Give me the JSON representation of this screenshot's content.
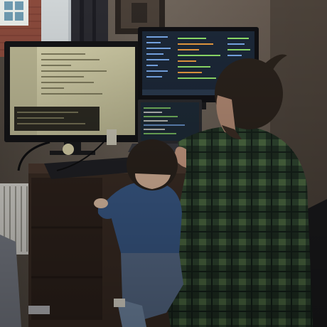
{
  "photo": {
    "scene": "desk-with-monitors",
    "colors": {
      "wall": "#6e645a",
      "wall_shadow": "#3a332c",
      "window_light": "#cfd4d6",
      "brick": "#8a4a3c",
      "curtain": "#2a2a30",
      "desk": "#3a2c24",
      "monitor_left_screen": "#cdc9a6",
      "monitor_top_screen": "#1c2838",
      "laptop_screen": "#1d2a36",
      "code_green": "#8fe06a",
      "code_orange": "#e89a40",
      "code_blue": "#78a8e8",
      "plaid_dark": "#1f2e22",
      "plaid_light": "#4d6a42",
      "child_shirt": "#3a5a88",
      "hair": "#2a221c",
      "chair": "#1a1a1c"
    }
  }
}
